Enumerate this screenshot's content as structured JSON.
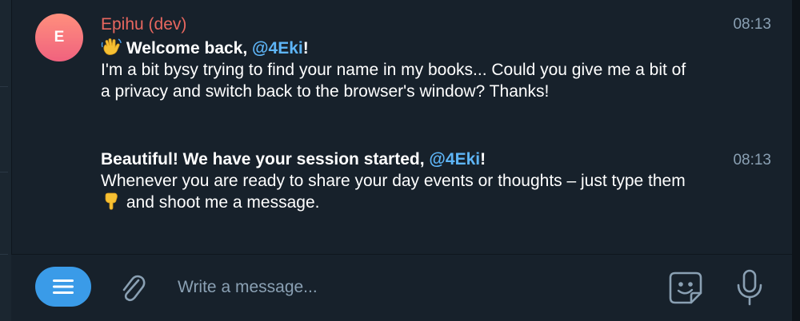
{
  "colors": {
    "background": "#17212b",
    "sender_name": "#e8675f",
    "mention": "#5eb5f7",
    "timestamp": "#8aa0b3",
    "menu_button": "#3a9be8"
  },
  "messages": [
    {
      "avatar_initial": "E",
      "sender": "Epihu (dev)",
      "time": "08:13",
      "emoji_icon": "waving-hand-icon",
      "greeting": "Welcome back, ",
      "mention": "@4Eki",
      "greeting_end": "!",
      "body": "I'm a bit bysy trying to find your name in my books... Could you give me a bit of a privacy and switch back to the browser's window? Thanks!"
    },
    {
      "time": "08:13",
      "headline": "Beautiful! We have your session started, ",
      "mention": "@4Eki",
      "headline_end": "!",
      "body_before": "Whenever you are ready to share your day events or thoughts – just type them ",
      "emoji_icon": "pointing-down-hand-icon",
      "body_after": " and shoot me a message."
    }
  ],
  "composer": {
    "menu_icon": "menu-icon",
    "attach_icon": "paperclip-icon",
    "placeholder": "Write a message...",
    "sticker_icon": "sticker-icon",
    "mic_icon": "microphone-icon"
  }
}
